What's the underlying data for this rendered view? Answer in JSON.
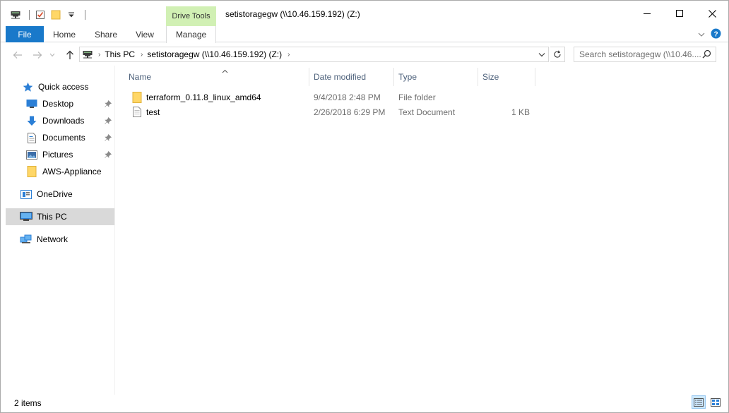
{
  "window": {
    "title": "setistoragegw (\\\\10.46.159.192) (Z:)",
    "context_tab_group": "Drive Tools"
  },
  "ribbon": {
    "tabs": [
      {
        "label": "File"
      },
      {
        "label": "Home"
      },
      {
        "label": "Share"
      },
      {
        "label": "View"
      },
      {
        "label": "Manage"
      }
    ]
  },
  "address": {
    "crumbs": [
      {
        "label": "This PC"
      },
      {
        "label": "setistoragegw (\\\\10.46.159.192) (Z:)"
      }
    ]
  },
  "search": {
    "placeholder": "Search setistoragegw (\\\\10.46...."
  },
  "sidebar": {
    "items": [
      {
        "label": "Quick access",
        "icon": "star-icon"
      },
      {
        "label": "Desktop",
        "icon": "desktop-icon",
        "pinned": true
      },
      {
        "label": "Downloads",
        "icon": "download-arrow-icon",
        "pinned": true
      },
      {
        "label": "Documents",
        "icon": "document-icon",
        "pinned": true
      },
      {
        "label": "Pictures",
        "icon": "picture-icon",
        "pinned": true
      },
      {
        "label": "AWS-Appliance",
        "icon": "folder-icon"
      },
      {
        "label": "OneDrive",
        "icon": "onedrive-icon"
      },
      {
        "label": "This PC",
        "icon": "computer-icon",
        "selected": true
      },
      {
        "label": "Network",
        "icon": "network-icon"
      }
    ]
  },
  "columns": {
    "name": "Name",
    "date": "Date modified",
    "type": "Type",
    "size": "Size"
  },
  "files": [
    {
      "name": "terraform_0.11.8_linux_amd64",
      "date": "9/4/2018 2:48 PM",
      "type": "File folder",
      "size": "",
      "icon": "folder-icon"
    },
    {
      "name": "test",
      "date": "2/26/2018 6:29 PM",
      "type": "Text Document",
      "size": "1 KB",
      "icon": "text-file-icon"
    }
  ],
  "status": {
    "item_count": "2 items"
  },
  "colors": {
    "file_tab": "#1979ca",
    "context_tab": "#d1f0b4",
    "selection": "#d9d9d9",
    "column_header_text": "#4c607a",
    "folder_yellow": "#ffd767"
  }
}
